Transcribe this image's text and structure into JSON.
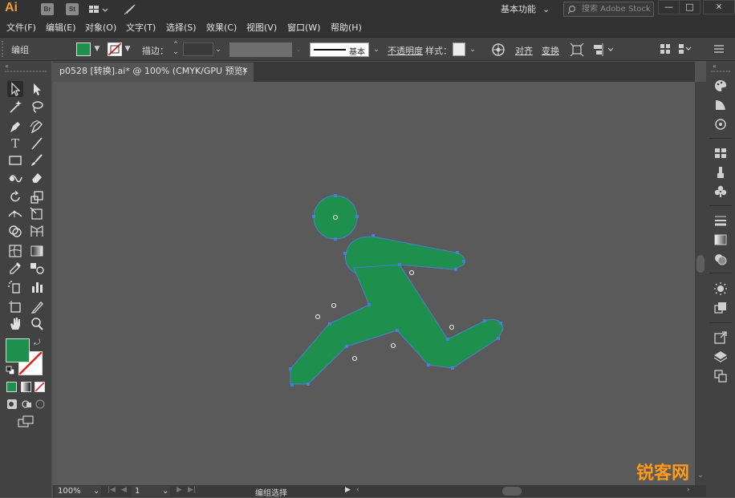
{
  "app": {
    "logo": "Ai",
    "chips": [
      "Br",
      "St"
    ],
    "workspace_label": "基本功能",
    "search_placeholder": "搜索 Adobe Stock",
    "min_glyph": "—",
    "max_glyph": "□",
    "close_glyph": "✕"
  },
  "menu": [
    "文件(F)",
    "编辑(E)",
    "对象(O)",
    "文字(T)",
    "选择(S)",
    "效果(C)",
    "视图(V)",
    "窗口(W)",
    "帮助(H)"
  ],
  "control": {
    "group_label": "编组",
    "stroke_label": "描边：",
    "brush_label": "基本",
    "opacity_label": "不透明度",
    "style_label": "样式：",
    "align_label": "对齐",
    "transform_label": "变换",
    "fill_color": "#1f8f4e"
  },
  "document": {
    "tab_title": "p0528 [转换].ai* @ 100% (CMYK/GPU 预览)",
    "tab_close": "✕"
  },
  "artwork": {
    "fill_color": "#1f8f4e",
    "path_color": "#4a7fd6"
  },
  "status": {
    "zoom": "100%",
    "artboard": "1",
    "mode": "编组选择"
  },
  "watermark": "锐客网"
}
